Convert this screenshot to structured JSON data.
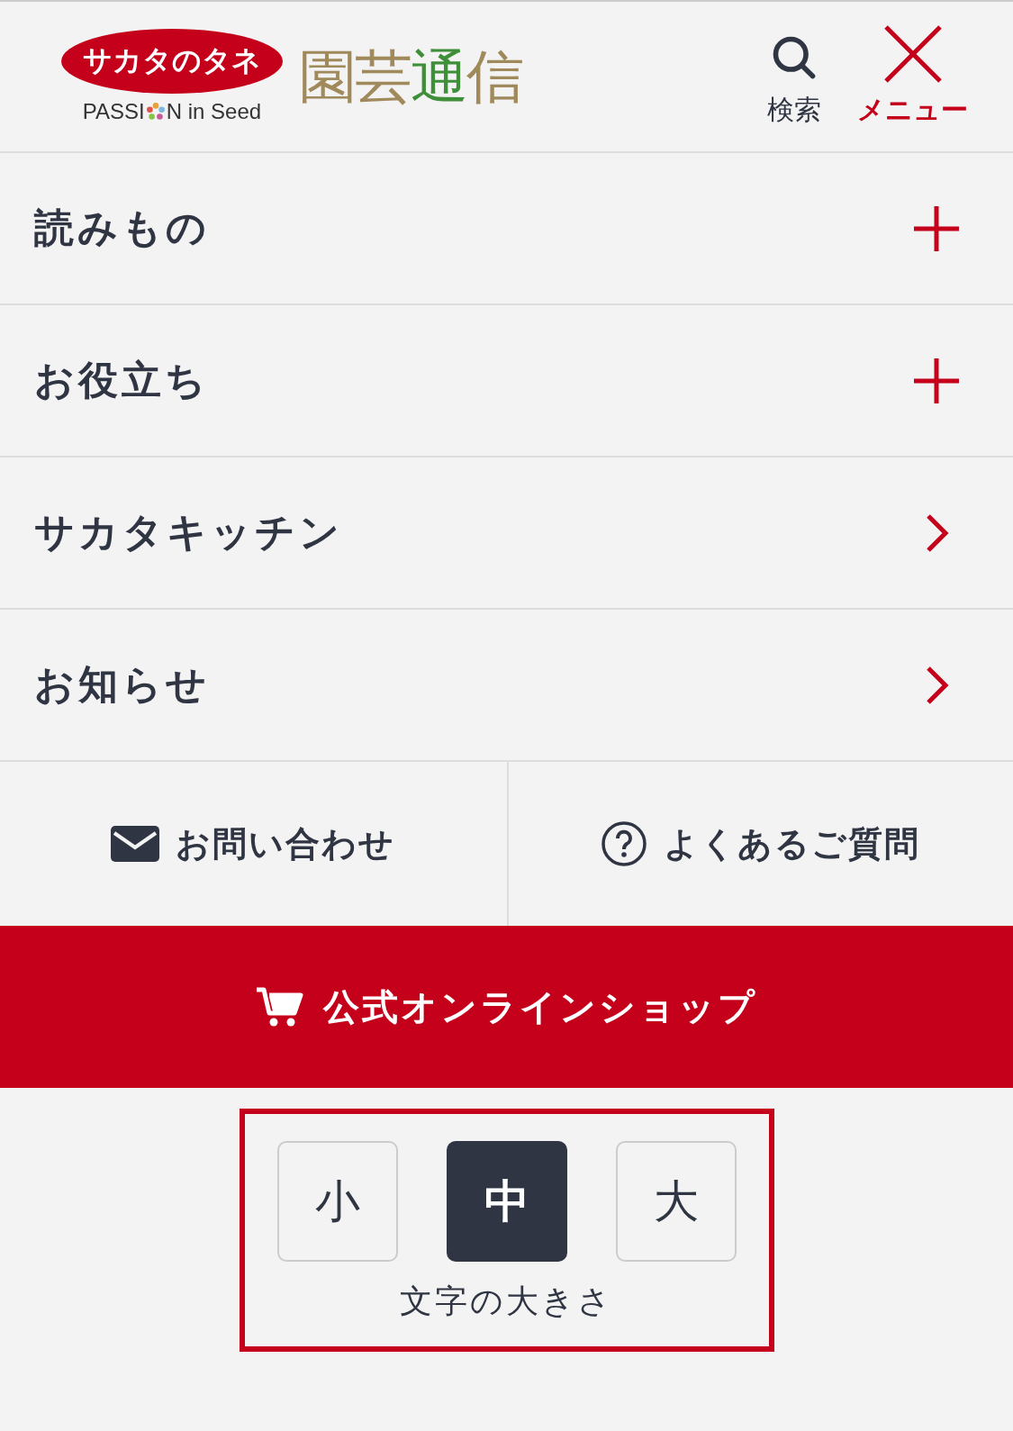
{
  "header": {
    "brand": "サカタのタネ",
    "tagline_before": "PASSI",
    "tagline_after": "N in Seed",
    "site_name": [
      {
        "char": "園",
        "color": "#a08a5c"
      },
      {
        "char": "芸",
        "color": "#a08a5c"
      },
      {
        "char": "通",
        "color": "#3f8f3a"
      },
      {
        "char": "信",
        "color": "#a08a5c"
      }
    ],
    "search_label": "検索",
    "menu_label": "メニュー"
  },
  "menu": [
    {
      "label": "読みもの",
      "kind": "expand"
    },
    {
      "label": "お役立ち",
      "kind": "expand"
    },
    {
      "label": "サカタキッチン",
      "kind": "link"
    },
    {
      "label": "お知らせ",
      "kind": "link"
    }
  ],
  "sub_links": [
    {
      "label": "お問い合わせ",
      "kind": "mail"
    },
    {
      "label": "よくあるご質問",
      "kind": "help"
    }
  ],
  "shop_button": {
    "label": "公式オンラインショップ"
  },
  "font_size": {
    "label": "文字の大きさ",
    "options": [
      {
        "label": "小",
        "selected": false
      },
      {
        "label": "中",
        "selected": true
      },
      {
        "label": "大",
        "selected": false
      }
    ]
  }
}
